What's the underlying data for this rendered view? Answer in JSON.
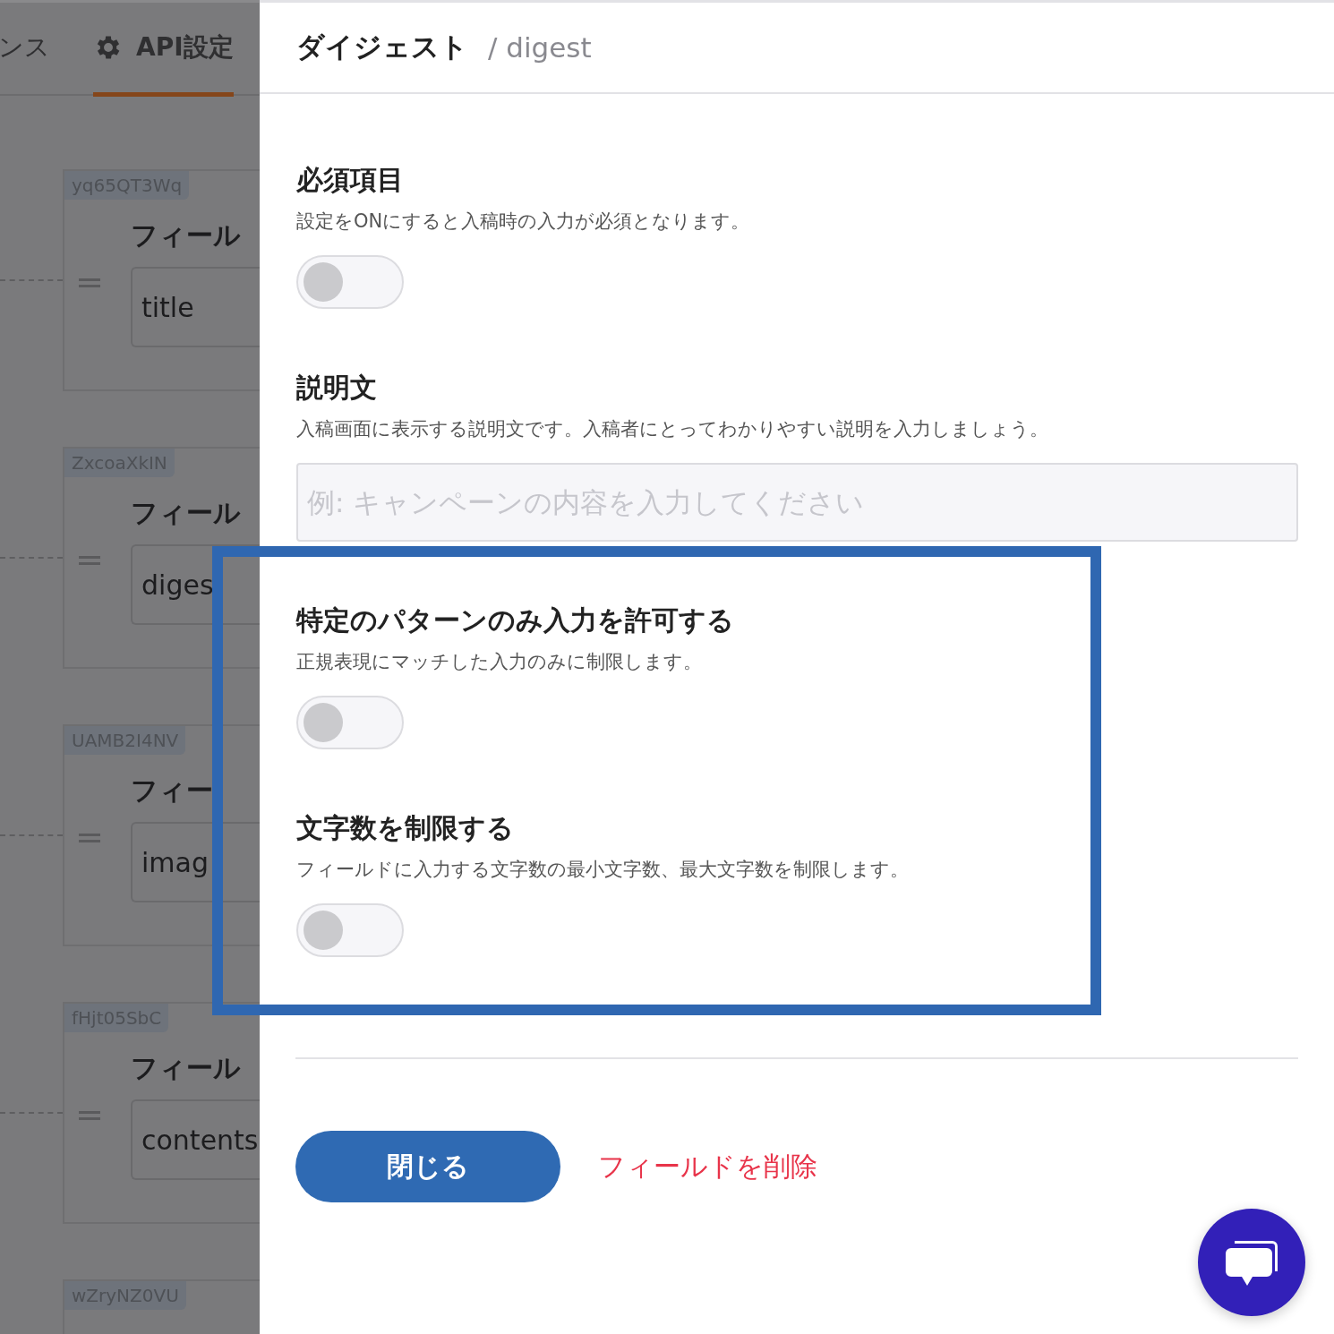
{
  "background_page": {
    "tabs": [
      {
        "label": "ンス",
        "kind": "text",
        "selected": false
      },
      {
        "label": "API設定",
        "kind": "settings",
        "selected": true
      }
    ],
    "fields": [
      {
        "id": "yq65QT3Wq",
        "heading": "フィール",
        "value": "title"
      },
      {
        "id": "ZxcoaXkIN",
        "heading": "フィール",
        "value": "diges"
      },
      {
        "id": "UAMB2I4NV",
        "heading": "フィー",
        "value": "imag"
      },
      {
        "id": "fHjt05SbC",
        "heading": "フィール",
        "value": "contents"
      },
      {
        "id": "wZryNZ0VU"
      }
    ]
  },
  "drawer": {
    "title": "ダイジェスト",
    "api_name": "/ digest",
    "sections": [
      {
        "kind": "toggle",
        "title": "必須項目",
        "description": "設定をONにすると入稿時の入力が必須となります。",
        "on": false
      },
      {
        "kind": "text",
        "title": "説明文",
        "description": "入稿画面に表示する説明文です。入稿者にとってわかりやすい説明を入力しましょう。",
        "placeholder": "例: キャンペーンの内容を入力してください"
      },
      {
        "kind": "toggle",
        "title": "特定のパターンのみ入力を許可する",
        "description": "正規表現にマッチした入力のみに制限します。",
        "on": false
      },
      {
        "kind": "toggle",
        "title": "文字数を制限する",
        "description": "フィールドに入力する文字数の最小文字数、最大文字数を制限します。",
        "on": false
      }
    ],
    "close_button": "閉じる",
    "delete_link": "フィールドを削除"
  }
}
